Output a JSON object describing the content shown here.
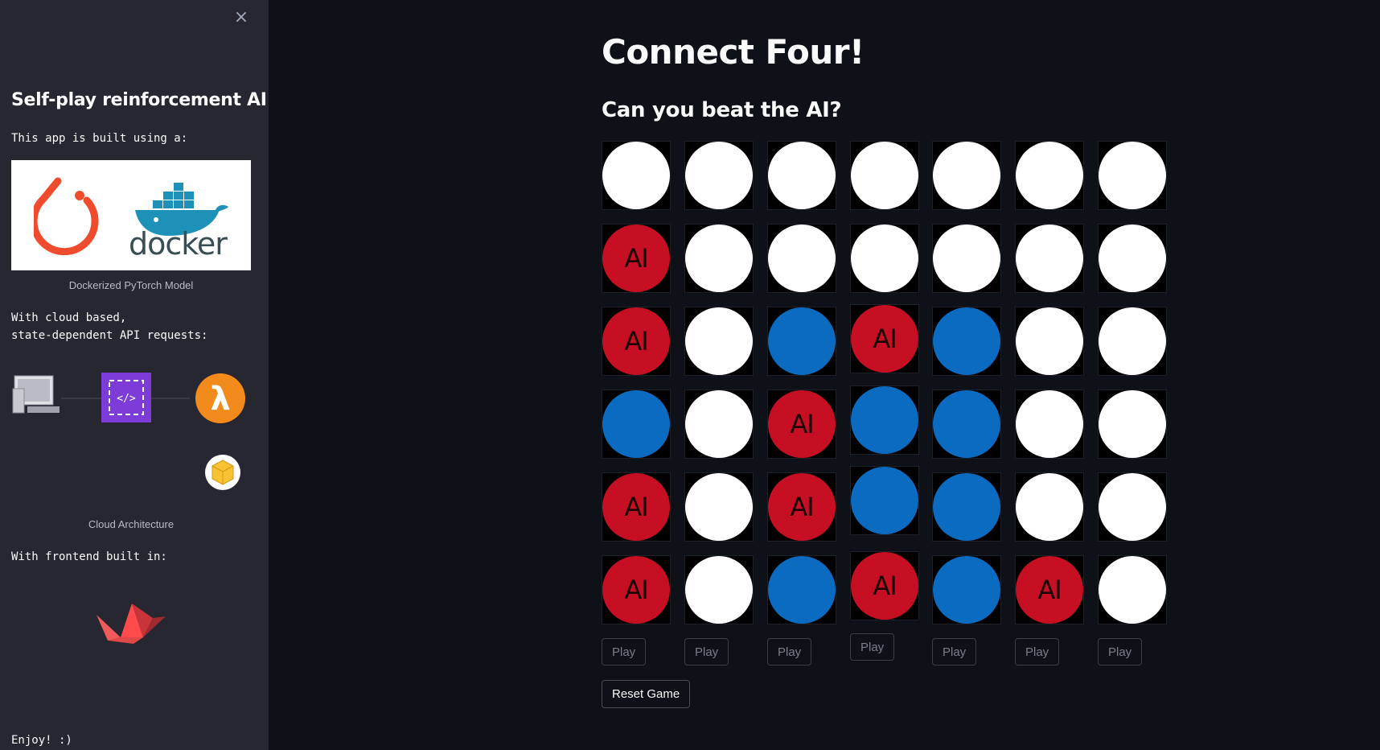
{
  "sidebar": {
    "close_label": "×",
    "title": "Self-play reinforcement AI",
    "built_with": "This app is built using a:",
    "logo_text": "docker",
    "logo_caption": "Dockerized PyTorch Model",
    "cloud_text": "With cloud based,\nstate-dependent API requests:",
    "arch_caption": "Cloud Architecture",
    "frontend_text": "With frontend built in:",
    "enjoy": "Enjoy! :)"
  },
  "main": {
    "title": "Connect Four!",
    "subtitle": "Can you beat the AI?",
    "reset_label": "Reset Game"
  },
  "game": {
    "ai_label": "AI",
    "board": [
      [
        "empty",
        "empty",
        "empty",
        "empty",
        "empty",
        "empty",
        "empty"
      ],
      [
        "ai",
        "empty",
        "empty",
        "empty",
        "empty",
        "empty",
        "empty"
      ],
      [
        "ai",
        "empty",
        "human",
        "ai",
        "human",
        "empty",
        "empty"
      ],
      [
        "human",
        "empty",
        "ai",
        "human",
        "human",
        "empty",
        "empty"
      ],
      [
        "ai",
        "empty",
        "ai",
        "human",
        "human",
        "empty",
        "empty"
      ],
      [
        "ai",
        "empty",
        "human",
        "ai",
        "human",
        "ai",
        "empty"
      ]
    ],
    "play_labels": [
      "Play",
      "Play",
      "Play",
      "Play",
      "Play",
      "Play",
      "Play"
    ]
  },
  "colors": {
    "ai": "#c60f22",
    "human": "#0a6bc0",
    "empty": "#ffffff",
    "background": "#0e1117",
    "sidebar": "#262730"
  },
  "icons": {
    "close": "close-icon",
    "pytorch": "pytorch-logo-icon",
    "docker": "docker-whale-icon",
    "computer": "computer-icon",
    "api_gateway": "api-gateway-icon",
    "lambda": "lambda-icon",
    "package": "package-icon",
    "streamlit": "streamlit-boat-icon"
  }
}
